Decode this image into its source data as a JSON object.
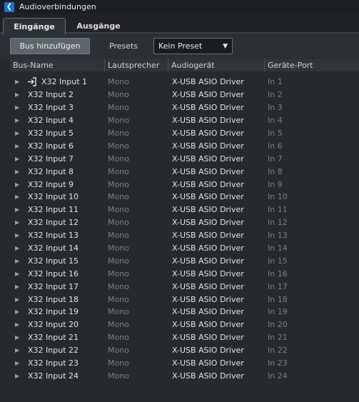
{
  "window": {
    "title": "Audioverbindungen"
  },
  "tabs": [
    {
      "label": "Eingänge",
      "active": true
    },
    {
      "label": "Ausgänge",
      "active": false
    }
  ],
  "toolbar": {
    "add_bus_label": "Bus hinzufügen",
    "presets_label": "Presets",
    "preset_value": "Kein Preset",
    "dropdown_icon": "triangle-down"
  },
  "columns": [
    "Bus-Name",
    "Lautsprecher",
    "Audiogerät",
    "Geräte-Port"
  ],
  "rows": [
    {
      "name": "X32 Input 1",
      "speaker": "Mono",
      "device": "X-USB ASIO Driver",
      "port": "In 1"
    },
    {
      "name": "X32 Input 2",
      "speaker": "Mono",
      "device": "X-USB ASIO Driver",
      "port": "In 2"
    },
    {
      "name": "X32 Input 3",
      "speaker": "Mono",
      "device": "X-USB ASIO Driver",
      "port": "In 3"
    },
    {
      "name": "X32 Input 4",
      "speaker": "Mono",
      "device": "X-USB ASIO Driver",
      "port": "In 4"
    },
    {
      "name": "X32 Input 5",
      "speaker": "Mono",
      "device": "X-USB ASIO Driver",
      "port": "In 5"
    },
    {
      "name": "X32 Input 6",
      "speaker": "Mono",
      "device": "X-USB ASIO Driver",
      "port": "In 6"
    },
    {
      "name": "X32 Input 7",
      "speaker": "Mono",
      "device": "X-USB ASIO Driver",
      "port": "In 7"
    },
    {
      "name": "X32 Input 8",
      "speaker": "Mono",
      "device": "X-USB ASIO Driver",
      "port": "In 8"
    },
    {
      "name": "X32 Input 9",
      "speaker": "Mono",
      "device": "X-USB ASIO Driver",
      "port": "In 9"
    },
    {
      "name": "X32 Input 10",
      "speaker": "Mono",
      "device": "X-USB ASIO Driver",
      "port": "In 10"
    },
    {
      "name": "X32 Input 11",
      "speaker": "Mono",
      "device": "X-USB ASIO Driver",
      "port": "In 11"
    },
    {
      "name": "X32 Input 12",
      "speaker": "Mono",
      "device": "X-USB ASIO Driver",
      "port": "In 12"
    },
    {
      "name": "X32 Input 13",
      "speaker": "Mono",
      "device": "X-USB ASIO Driver",
      "port": "In 13"
    },
    {
      "name": "X32 Input 14",
      "speaker": "Mono",
      "device": "X-USB ASIO Driver",
      "port": "In 14"
    },
    {
      "name": "X32 Input 15",
      "speaker": "Mono",
      "device": "X-USB ASIO Driver",
      "port": "In 15"
    },
    {
      "name": "X32 Input 16",
      "speaker": "Mono",
      "device": "X-USB ASIO Driver",
      "port": "In 16"
    },
    {
      "name": "X32 Input 17",
      "speaker": "Mono",
      "device": "X-USB ASIO Driver",
      "port": "In 17"
    },
    {
      "name": "X32 Input 18",
      "speaker": "Mono",
      "device": "X-USB ASIO Driver",
      "port": "In 18"
    },
    {
      "name": "X32 Input 19",
      "speaker": "Mono",
      "device": "X-USB ASIO Driver",
      "port": "In 19"
    },
    {
      "name": "X32 Input 20",
      "speaker": "Mono",
      "device": "X-USB ASIO Driver",
      "port": "In 20"
    },
    {
      "name": "X32 Input 21",
      "speaker": "Mono",
      "device": "X-USB ASIO Driver",
      "port": "In 21"
    },
    {
      "name": "X32 Input 22",
      "speaker": "Mono",
      "device": "X-USB ASIO Driver",
      "port": "In 22"
    },
    {
      "name": "X32 Input 23",
      "speaker": "Mono",
      "device": "X-USB ASIO Driver",
      "port": "In 23"
    },
    {
      "name": "X32 Input 24",
      "speaker": "Mono",
      "device": "X-USB ASIO Driver",
      "port": "In 24"
    }
  ],
  "colors": {
    "accent": "#1f6fd1",
    "background": "#262a2e",
    "muted_text": "#7b8188"
  }
}
